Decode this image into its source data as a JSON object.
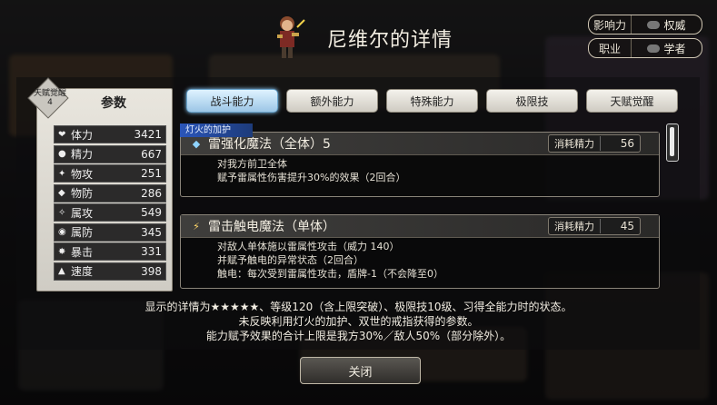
{
  "header": {
    "title": "尼维尔的详情",
    "badges": [
      {
        "key": "影响力",
        "value": "权威"
      },
      {
        "key": "职业",
        "value": "学者"
      }
    ]
  },
  "params": {
    "title": "参数",
    "awakening_label": "天赋觉醒",
    "awakening_level": "4",
    "stats": [
      {
        "icon": "heart-icon",
        "label": "体力",
        "value": "3421"
      },
      {
        "icon": "drop-icon",
        "label": "精力",
        "value": "667"
      },
      {
        "icon": "sword-icon",
        "label": "物攻",
        "value": "251"
      },
      {
        "icon": "shield-icon",
        "label": "物防",
        "value": "286"
      },
      {
        "icon": "spark-icon",
        "label": "属攻",
        "value": "549"
      },
      {
        "icon": "orb-icon",
        "label": "属防",
        "value": "345"
      },
      {
        "icon": "crit-icon",
        "label": "暴击",
        "value": "331"
      },
      {
        "icon": "boot-icon",
        "label": "速度",
        "value": "398"
      }
    ]
  },
  "tabs": [
    "战斗能力",
    "额外能力",
    "特殊能力",
    "极限技",
    "天赋觉醒"
  ],
  "active_tab": 0,
  "buff_label": "灯火的加护",
  "skills": [
    {
      "name": "雷强化魔法（全体）5",
      "cost_label": "消耗精力",
      "cost": "56",
      "desc": [
        "对我方前卫全体",
        "赋予雷属性伤害提升30%的效果（2回合）"
      ]
    },
    {
      "name": "雷击触电魔法（单体）",
      "cost_label": "消耗精力",
      "cost": "45",
      "desc": [
        "对敌人单体施以雷属性攻击（威力 140）",
        "并赋予触电的异常状态（2回合）",
        "触电：每次受到雷属性攻击，盾牌-1（不会降至0）"
      ]
    }
  ],
  "notes": [
    "显示的详情为★★★★★、等级120（含上限突破）、极限技10级、习得全能力时的状态。",
    "未反映利用灯火的加护、双世的戒指获得的参数。",
    "能力赋予效果的合计上限是我方30%／敌人50%（部分除外）。"
  ],
  "close_label": "关闭",
  "colors": {
    "active_tab": "#9cc6e6",
    "buff": "#2a55b8"
  }
}
